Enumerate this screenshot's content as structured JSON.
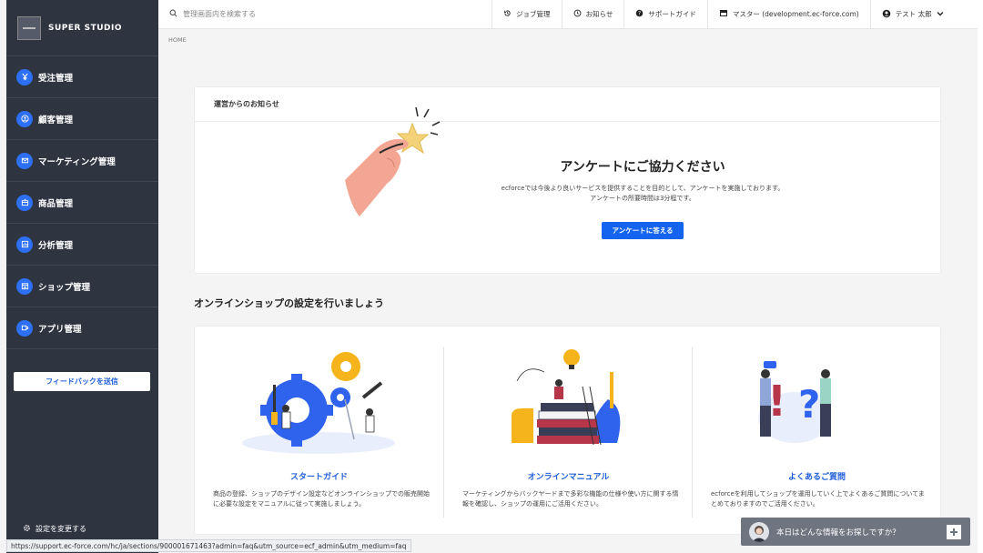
{
  "brand": {
    "name": "SUPER STUDIO"
  },
  "sidebar": {
    "items": [
      {
        "label": "受注管理",
        "icon": "yen-icon"
      },
      {
        "label": "顧客管理",
        "icon": "user-icon"
      },
      {
        "label": "マーケティング管理",
        "icon": "mail-icon"
      },
      {
        "label": "商品管理",
        "icon": "box-icon"
      },
      {
        "label": "分析管理",
        "icon": "chart-icon"
      },
      {
        "label": "ショップ管理",
        "icon": "shop-icon"
      },
      {
        "label": "アプリ管理",
        "icon": "app-icon"
      }
    ],
    "feedback_label": "フィードバックを送信",
    "settings_label": "設定を変更する"
  },
  "topbar": {
    "search_placeholder": "管理画面内を検索する",
    "job": "ジョブ管理",
    "news": "お知らせ",
    "support": "サポートガイド",
    "master": "マスター (development.ec-force.com)",
    "user": "テスト 太郎"
  },
  "breadcrumb": "HOME",
  "notice": {
    "header": "運営からのお知らせ",
    "title": "アンケートにご協力ください",
    "line1": "ecforceでは今後より良いサービスを提供することを目的として、アンケートを実施しております。",
    "line2": "アンケートの所要時間は3分程です。",
    "button": "アンケートに答える"
  },
  "setup": {
    "heading": "オンラインショップの設定を行いましょう",
    "columns": [
      {
        "title": "スタートガイド",
        "desc": "商品の登録、ショップのデザイン設定などオンラインショップでの販売開始に必要な設定をマニュアルに従って実施しましょう。"
      },
      {
        "title": "オンラインマニュアル",
        "desc": "マーケティングからバックヤードまで多彩な機能の仕様や使い方に関する情報を確認し、ショップの運用にご活用ください。"
      },
      {
        "title": "よくあるご質問",
        "desc": "ecforceを利用してショップを運用していく上でよくあるご質問についてまとめておりますのでご活用ください。"
      }
    ]
  },
  "status_url": "https://support.ec-force.com/hc/ja/sections/900001671463?admin=faq&utm_source=ecf_admin&utm_medium=faq",
  "chat": {
    "text": "本日はどんな情報をお探しですか？"
  },
  "colors": {
    "sidebar": "#2f3441",
    "accent": "#1464f0",
    "link": "#1f5fd8"
  }
}
